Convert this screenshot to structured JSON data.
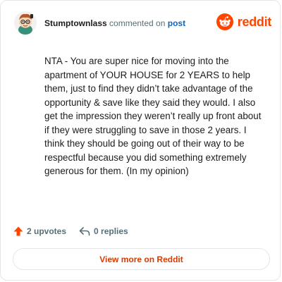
{
  "header": {
    "username": "Stumptownlass",
    "action": "commented on",
    "post_link": "post",
    "brand": "reddit"
  },
  "comment": {
    "text": "NTA - You are super nice for moving into the apartment of YOUR HOUSE for 2 YEARS to help them, just to find they didn’t take advantage of the opportunity & save like they said they would. I also get the impression they weren’t really up front about if they were struggling to save in those 2 years. I think they should be going out of their way to be respectful because you did something extremely generous for them. (In my opinion)"
  },
  "stats": {
    "upvotes": "2 upvotes",
    "replies": "0 replies",
    "upvote_icon": "upvote-arrow-icon",
    "reply_icon": "reply-icon"
  },
  "footer": {
    "view_more": "View more on Reddit"
  },
  "colors": {
    "brand": "#ff4500",
    "link": "#0a66c2",
    "button_text": "#d93a00",
    "muted": "#576f76"
  }
}
